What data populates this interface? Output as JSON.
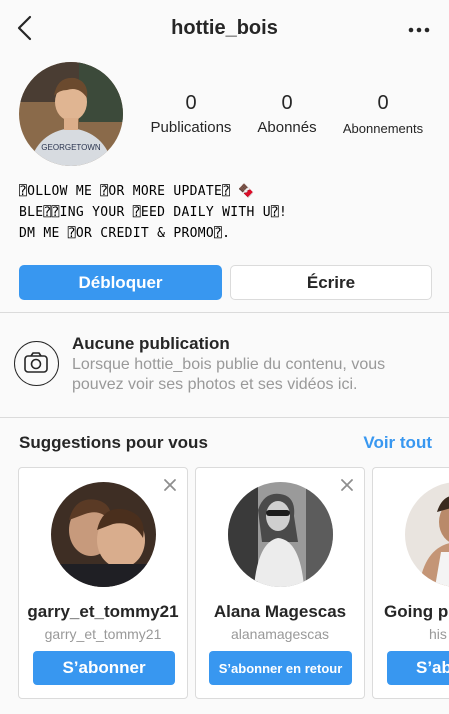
{
  "header": {
    "username": "hottie_bois"
  },
  "stats": [
    {
      "value": "0",
      "label": "Publications"
    },
    {
      "value": "0",
      "label": "Abonnés"
    },
    {
      "value": "0",
      "label": "Abonnements"
    }
  ],
  "bio": {
    "line1": "⍰OLLOW ME ⍰OR MORE UPDATE⍰ 🍫",
    "line2": "BLE⍰⍰ING YOUR ⍰EED DAILY WITH U⍰!",
    "line3": "DM ME ⍰OR CREDIT & PROMO⍰."
  },
  "actions": {
    "unblock_label": "Débloquer",
    "message_label": "Écrire"
  },
  "empty_state": {
    "title": "Aucune publication",
    "description": "Lorsque hottie_bois publie du contenu, vous pouvez voir ses photos et ses vidéos ici."
  },
  "suggestions": {
    "title": "Suggestions pour vous",
    "see_all": "Voir tout",
    "cards": [
      {
        "name": "garry_et_tommy21",
        "handle": "garry_et_tommy21",
        "button": "S’abonner"
      },
      {
        "name": "Alana Magescas",
        "handle": "alanamagescas",
        "button": "S’abonner en retour"
      },
      {
        "name": "Going pr",
        "handle": "his",
        "button": "S’ab"
      }
    ]
  },
  "colors": {
    "accent": "#3897f0",
    "text": "#262626",
    "muted": "#999999",
    "border": "#dbdbdb",
    "background": "#fafafa"
  },
  "icons": {
    "back": "chevron-left-icon",
    "more": "more-horizontal-icon",
    "camera": "camera-icon",
    "close": "close-icon"
  }
}
